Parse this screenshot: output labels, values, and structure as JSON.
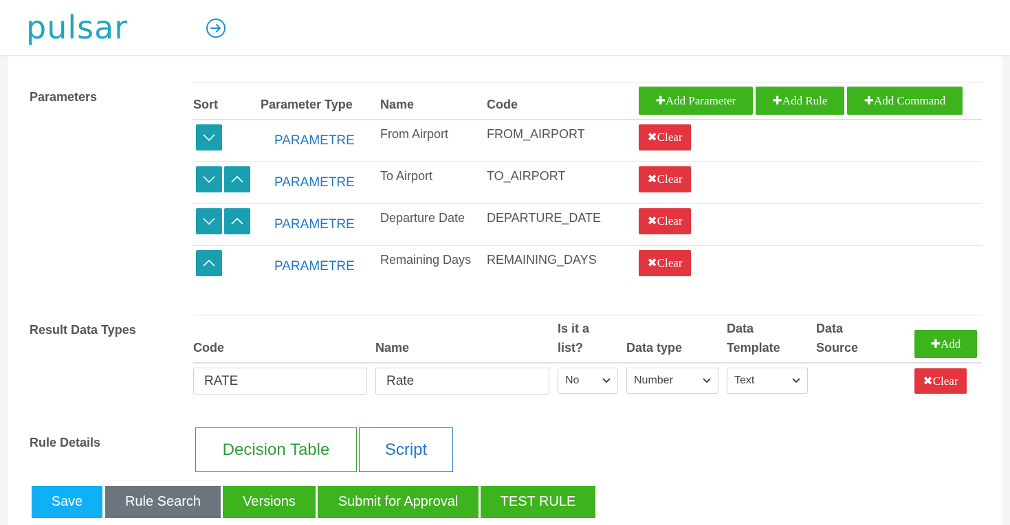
{
  "header": {
    "logo_text": "pulsar"
  },
  "parameters": {
    "section_label": "Parameters",
    "columns": {
      "sort": "Sort",
      "parameter_type": "Parameter Type",
      "name": "Name",
      "code": "Code"
    },
    "buttons": {
      "add_parameter": "Add Parameter",
      "add_rule": "Add Rule",
      "add_command": "Add Command",
      "clear": "Clear"
    },
    "rows": [
      {
        "type": "PARAMETRE",
        "name": "From Airport",
        "code": "FROM_AIRPORT"
      },
      {
        "type": "PARAMETRE",
        "name": "To Airport",
        "code": "TO_AIRPORT"
      },
      {
        "type": "PARAMETRE",
        "name": "Departure Date",
        "code": "DEPARTURE_DATE"
      },
      {
        "type": "PARAMETRE",
        "name": "Remaining Days",
        "code": "REMAINING_DAYS"
      }
    ]
  },
  "result_types": {
    "section_label": "Result Data Types",
    "columns": {
      "code": "Code",
      "name": "Name",
      "is_list_1": "Is it a",
      "is_list_2": "list?",
      "data_type": "Data type",
      "template_1": "Data",
      "template_2": "Template",
      "source_1": "Data",
      "source_2": "Source"
    },
    "buttons": {
      "add": "Add",
      "clear": "Clear"
    },
    "row": {
      "code": "RATE",
      "name": "Rate",
      "is_list": "No",
      "data_type": "Number",
      "template": "Text"
    }
  },
  "rule_details": {
    "section_label": "Rule Details",
    "tabs": {
      "decision_table": "Decision Table",
      "script": "Script"
    }
  },
  "actions": {
    "save": "Save",
    "rule_search": "Rule Search",
    "versions": "Versions",
    "submit": "Submit for Approval",
    "test_rule": "TEST RULE"
  },
  "colors": {
    "brand": "#1fa6c0",
    "green": "#3db31e",
    "red": "#e2353f",
    "teal": "#1a9fb0",
    "link": "#1e78c8",
    "save_blue": "#0fb0f5",
    "gray": "#6c757d"
  }
}
